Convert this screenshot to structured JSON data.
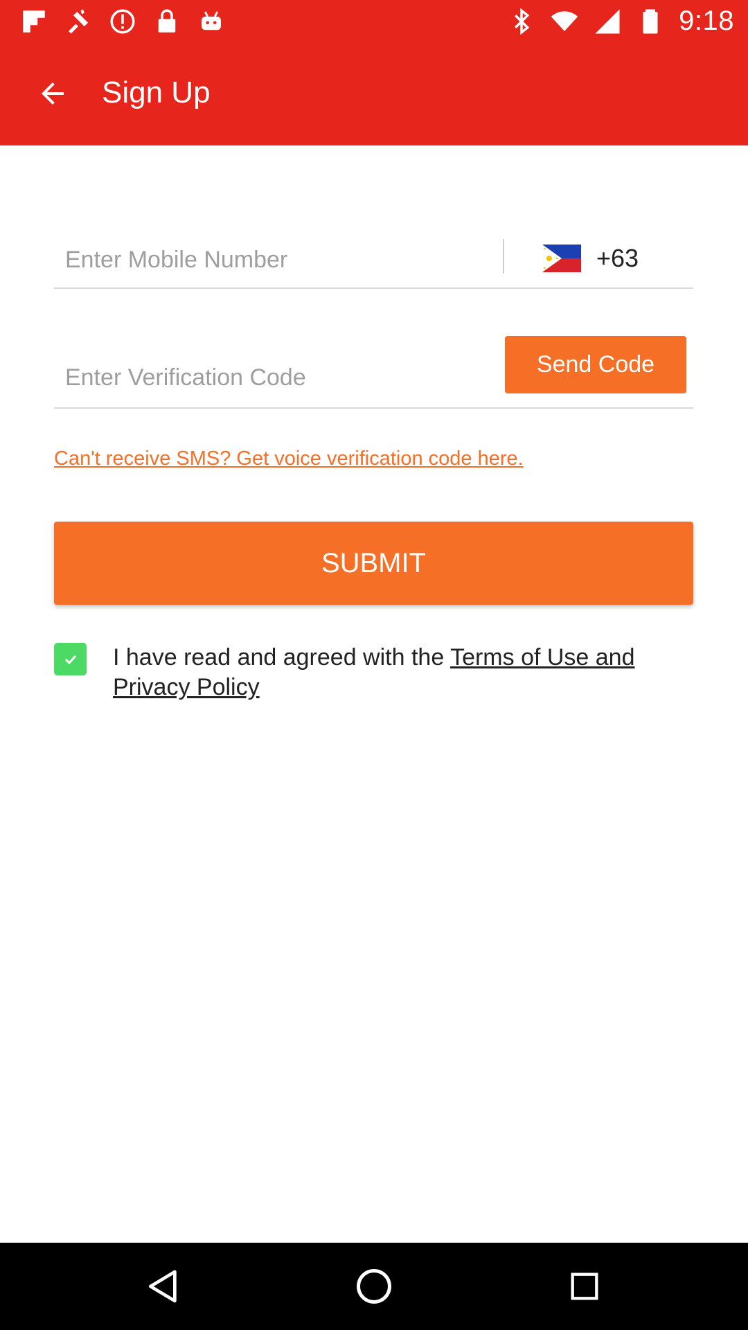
{
  "status_bar": {
    "time": "9:18",
    "icons": [
      "flipboard-icon",
      "fake-gps-icon",
      "info-icon",
      "lock-icon",
      "android-icon",
      "bluetooth-icon",
      "wifi-icon",
      "signal-icon",
      "battery-icon"
    ]
  },
  "app_bar": {
    "title": "Sign Up",
    "color": "#E6251D"
  },
  "mobile": {
    "placeholder": "Enter Mobile Number",
    "value": "",
    "country_code": "+63",
    "country_flag": "philippines-flag-icon"
  },
  "verification": {
    "placeholder": "Enter Verification Code",
    "value": "",
    "send_label": "Send Code"
  },
  "voice_link": "Can't receive SMS? Get voice verification code here.",
  "submit_label": "SUBMIT",
  "agreement": {
    "checked": true,
    "prefix": "I have read and agreed with the ",
    "link": "Terms of Use and Privacy Policy"
  },
  "colors": {
    "accent": "#F56F27",
    "header": "#E6251D",
    "checkbox": "#4CD964"
  },
  "nav_bar": {
    "buttons": [
      "back-nav-icon",
      "home-nav-icon",
      "recents-nav-icon"
    ]
  }
}
